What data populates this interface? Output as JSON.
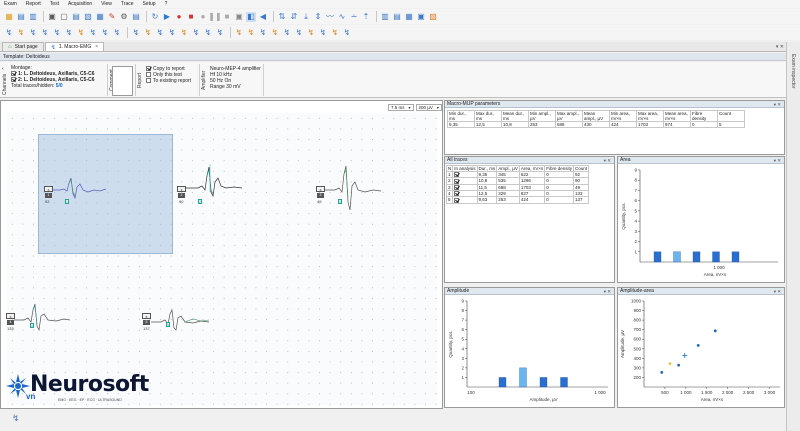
{
  "menu": [
    "Exam",
    "Report",
    "Test",
    "Acquisition",
    "View",
    "Trace",
    "Setup",
    "?"
  ],
  "tabs": [
    {
      "label": "Start page",
      "active": false
    },
    {
      "label": "1. Macro-EMG",
      "active": true,
      "close": "×"
    }
  ],
  "tab_controls": "▾ ✕",
  "exam_inspector": "Exam inspector",
  "template_label": "Template: Deltoideus",
  "ribbon": {
    "channels_label": "Channels",
    "montage_title": "Montage:",
    "montage_items": [
      "1: L. Deltoideus, Axillaris, C5-C6",
      "2: L. Deltoideus, Axillaris, C5-C6"
    ],
    "total_traces_label": "Total traces/hidden:",
    "total_traces_value": "5/0",
    "comment_label": "Comment",
    "report_label": "Report",
    "report_opts": [
      "Copy to report",
      "Only this test",
      "To existing report"
    ],
    "amplifier_label": "Amplifier",
    "amp_title": "Neuro-MEP-4 amplifier",
    "amp_lines": [
      "Hf  10 kHz",
      "50 Hz  On",
      "Range 30 mV"
    ]
  },
  "combos": {
    "timebase": "7.5 ms",
    "sensitivity": "200 µV"
  },
  "traces": [
    {
      "num": "1",
      "sub": "x",
      "label": "92",
      "marker": "1",
      "color": "#5a5ac0"
    },
    {
      "num": "2",
      "sub": "x",
      "label": "90",
      "marker": "2",
      "color": "#2a9a9a"
    },
    {
      "num": "3",
      "sub": "x",
      "label": "49",
      "marker": "3",
      "color": "#666"
    },
    {
      "num": "4",
      "sub": "x",
      "label": "133",
      "marker": "4",
      "color": "#3c8ca0"
    },
    {
      "num": "5",
      "sub": "x",
      "label": "137",
      "marker": "5",
      "color": "#3a8c5a"
    }
  ],
  "logo": {
    "name": "Neurosoft",
    "vn": "vn",
    "sub": "EMG · EEG · EP · ECG · ULTRASOUND"
  },
  "macro_mup": {
    "title": "Macro-MUP parameters",
    "headers": [
      "Min dur., ms",
      "Max dur., ms",
      "Mean dur., ms",
      "Min ampl., µV",
      "Max ampl., µV",
      "Mean ampl., µV",
      "Min area, nV×s",
      "Max area, nV×s",
      "Mean area, nV×s",
      "Fibre density",
      "Count"
    ],
    "values": [
      "9,35",
      "12,5",
      "10,8",
      "253",
      "688",
      "430",
      "424",
      "1703",
      "974",
      "0",
      "5"
    ]
  },
  "all_traces": {
    "title": "All traces",
    "headers": [
      "N",
      "In analysis",
      "Dur., ms",
      "Ampl., µV",
      "Area, nV×s",
      "Fibre density",
      "Count"
    ],
    "rows": [
      [
        "1",
        "",
        "9,35",
        "345",
        "622",
        "0",
        "92"
      ],
      [
        "2",
        "",
        "10,8",
        "535",
        "1296",
        "0",
        "90"
      ],
      [
        "3",
        "",
        "11,5",
        "688",
        "1703",
        "0",
        "49"
      ],
      [
        "4",
        "",
        "12,5",
        "329",
        "827",
        "0",
        "133"
      ],
      [
        "5",
        "",
        "9,63",
        "253",
        "424",
        "0",
        "137"
      ]
    ]
  },
  "area_panel": {
    "title": "Area"
  },
  "amplitude_panel": {
    "title": "Amplitude"
  },
  "amparea_panel": {
    "title": "Amplitude-area"
  },
  "chart_data": [
    {
      "type": "bar",
      "id": "area",
      "xlabel": "Area, nV×s",
      "ylabel": "Quantity, pcs.",
      "yticks": [
        1,
        2,
        3,
        4,
        5,
        6,
        7,
        8,
        9
      ],
      "ylim": [
        0,
        9
      ],
      "xticks": [
        "1 000"
      ],
      "bars": [
        {
          "value": 1,
          "highlight": false
        },
        {
          "value": 1,
          "highlight": true
        },
        {
          "value": 1,
          "highlight": false
        },
        {
          "value": 1,
          "highlight": false
        },
        {
          "value": 1,
          "highlight": false
        }
      ]
    },
    {
      "type": "bar",
      "id": "amplitude",
      "xlabel": "Amplitude, µV",
      "ylabel": "Quantity, pcs.",
      "yticks": [
        1,
        2,
        3,
        4,
        5,
        6,
        7,
        8,
        9
      ],
      "ylim": [
        0,
        9
      ],
      "xticks": [
        "100",
        "1 000"
      ],
      "bars": [
        {
          "value": 1,
          "highlight": false
        },
        {
          "value": 2,
          "highlight": true
        },
        {
          "value": 1,
          "highlight": false
        },
        {
          "value": 1,
          "highlight": false
        }
      ]
    },
    {
      "type": "scatter",
      "id": "amplitude-area",
      "xlabel": "Area, nV×s",
      "ylabel": "Amplitude, µV",
      "xlim": [
        0,
        3250
      ],
      "ylim": [
        100,
        1000
      ],
      "xticks": [
        500,
        1000,
        1500,
        2000,
        2500,
        3000
      ],
      "xtick_labels": [
        "500",
        "1 000",
        "1 500",
        "2 000",
        "2 500",
        "3 000"
      ],
      "yticks": [
        200,
        300,
        400,
        500,
        600,
        700,
        800,
        900,
        1000
      ],
      "points": [
        {
          "x": 424,
          "y": 253,
          "color": "#1a66cc"
        },
        {
          "x": 622,
          "y": 345,
          "color": "#e8c63a"
        },
        {
          "x": 827,
          "y": 329,
          "color": "#1a66cc"
        },
        {
          "x": 1296,
          "y": 535,
          "color": "#1a66cc"
        },
        {
          "x": 1703,
          "y": 688,
          "color": "#1a66cc"
        }
      ],
      "mean": {
        "x": 974,
        "y": 430
      }
    }
  ]
}
